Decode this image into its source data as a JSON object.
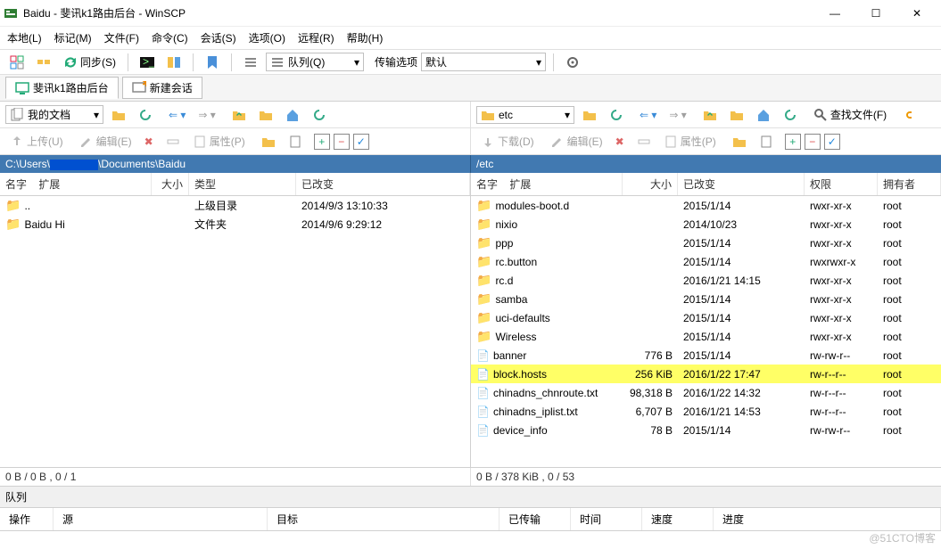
{
  "window": {
    "title": "Baidu - 斐讯k1路由后台 - WinSCP",
    "min": "—",
    "max": "☐",
    "close": "✕"
  },
  "menu": {
    "local": "本地(L)",
    "mark": "标记(M)",
    "file": "文件(F)",
    "command": "命令(C)",
    "session": "会话(S)",
    "option": "选项(O)",
    "remote": "远程(R)",
    "help": "帮助(H)"
  },
  "toolbar": {
    "sync": "同步(S)",
    "queue": "队列(Q)",
    "transopt": "传输选项",
    "default": "默认"
  },
  "tabs": {
    "session": "斐讯k1路由后台",
    "newsession": "新建会话"
  },
  "nav": {
    "left": {
      "drive": "我的文档"
    },
    "right": {
      "drive": "etc",
      "find": "查找文件(F)"
    }
  },
  "actions": {
    "left": {
      "upload": "上传(U)",
      "edit": "编辑(E)",
      "prop": "属性(P)"
    },
    "right": {
      "download": "下载(D)",
      "edit": "编辑(E)",
      "prop": "属性(P)"
    }
  },
  "paths": {
    "left_pre": "C:\\Users\\",
    "left_post": "\\Documents\\Baidu",
    "right": "/etc"
  },
  "cols": {
    "left": {
      "name": "名字",
      "ext": "扩展",
      "size": "大小",
      "type": "类型",
      "mod": "已改变"
    },
    "right": {
      "name": "名字",
      "ext": "扩展",
      "size": "大小",
      "mod": "已改变",
      "perm": "权限",
      "owner": "拥有者"
    }
  },
  "leftfiles": [
    {
      "icon": "up",
      "name": "..",
      "size": "",
      "type": "上级目录",
      "mod": "2014/9/3  13:10:33"
    },
    {
      "icon": "folder",
      "name": "Baidu Hi",
      "size": "",
      "type": "文件夹",
      "mod": "2014/9/6  9:29:12"
    }
  ],
  "rightfiles": [
    {
      "icon": "folder",
      "name": "modules-boot.d",
      "size": "",
      "mod": "2015/1/14",
      "perm": "rwxr-xr-x",
      "owner": "root"
    },
    {
      "icon": "folder",
      "name": "nixio",
      "size": "",
      "mod": "2014/10/23",
      "perm": "rwxr-xr-x",
      "owner": "root"
    },
    {
      "icon": "folder",
      "name": "ppp",
      "size": "",
      "mod": "2015/1/14",
      "perm": "rwxr-xr-x",
      "owner": "root"
    },
    {
      "icon": "folder",
      "name": "rc.button",
      "size": "",
      "mod": "2015/1/14",
      "perm": "rwxrwxr-x",
      "owner": "root"
    },
    {
      "icon": "folder",
      "name": "rc.d",
      "size": "",
      "mod": "2016/1/21 14:15",
      "perm": "rwxr-xr-x",
      "owner": "root"
    },
    {
      "icon": "folder",
      "name": "samba",
      "size": "",
      "mod": "2015/1/14",
      "perm": "rwxr-xr-x",
      "owner": "root"
    },
    {
      "icon": "folder",
      "name": "uci-defaults",
      "size": "",
      "mod": "2015/1/14",
      "perm": "rwxr-xr-x",
      "owner": "root"
    },
    {
      "icon": "folder",
      "name": "Wireless",
      "size": "",
      "mod": "2015/1/14",
      "perm": "rwxr-xr-x",
      "owner": "root"
    },
    {
      "icon": "file",
      "name": "banner",
      "size": "776 B",
      "mod": "2015/1/14",
      "perm": "rw-rw-r--",
      "owner": "root"
    },
    {
      "icon": "file",
      "name": "block.hosts",
      "hl": true,
      "size": "256 KiB",
      "mod": "2016/1/22 17:47",
      "perm": "rw-r--r--",
      "owner": "root"
    },
    {
      "icon": "file",
      "name": "chinadns_chnroute.txt",
      "size": "98,318 B",
      "mod": "2016/1/22 14:32",
      "perm": "rw-r--r--",
      "owner": "root"
    },
    {
      "icon": "file",
      "name": "chinadns_iplist.txt",
      "size": "6,707 B",
      "mod": "2016/1/21 14:53",
      "perm": "rw-r--r--",
      "owner": "root"
    },
    {
      "icon": "file",
      "name": "device_info",
      "size": "78 B",
      "mod": "2015/1/14",
      "perm": "rw-rw-r--",
      "owner": "root"
    }
  ],
  "selection": {
    "left": "0 B / 0 B ,  0 / 1",
    "right": "0 B / 378 KiB ,  0 / 53"
  },
  "queue": {
    "title": "队列",
    "op": "操作",
    "source": "源",
    "target": "目标",
    "done": "已传输",
    "time": "时间",
    "speed": "速度",
    "progress": "进度"
  },
  "watermark": "@51CTO博客"
}
